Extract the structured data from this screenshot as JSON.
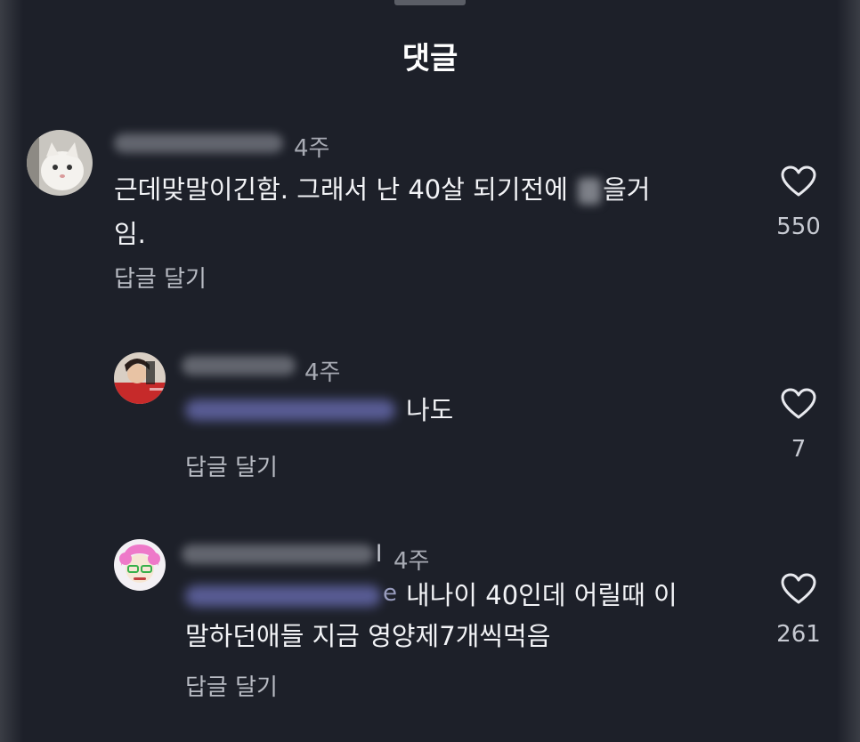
{
  "header": {
    "title": "댓글"
  },
  "comments": [
    {
      "time": "4주",
      "text_line1_pre": "근데맞말이긴함. 그래서 난 40살 되기전에 ",
      "text_line1_post": "을거",
      "text_line2": "임.",
      "reply_label": "답글 달기",
      "like_count": "550",
      "avatar": "white-cat-avatar"
    },
    {
      "time": "4주",
      "text": "나도",
      "reply_label": "답글 달기",
      "like_count": "7",
      "avatar": "red-figure-avatar"
    },
    {
      "time": "4주",
      "name_tail": "l",
      "mention_tail": "e",
      "text_line1": "내나이 40인데 어릴때 이",
      "text_line2": "말하던애들 지금 영양제7개씩먹음",
      "reply_label": "답글 달기",
      "like_count": "261",
      "avatar": "pink-hair-cartoon-avatar"
    }
  ]
}
